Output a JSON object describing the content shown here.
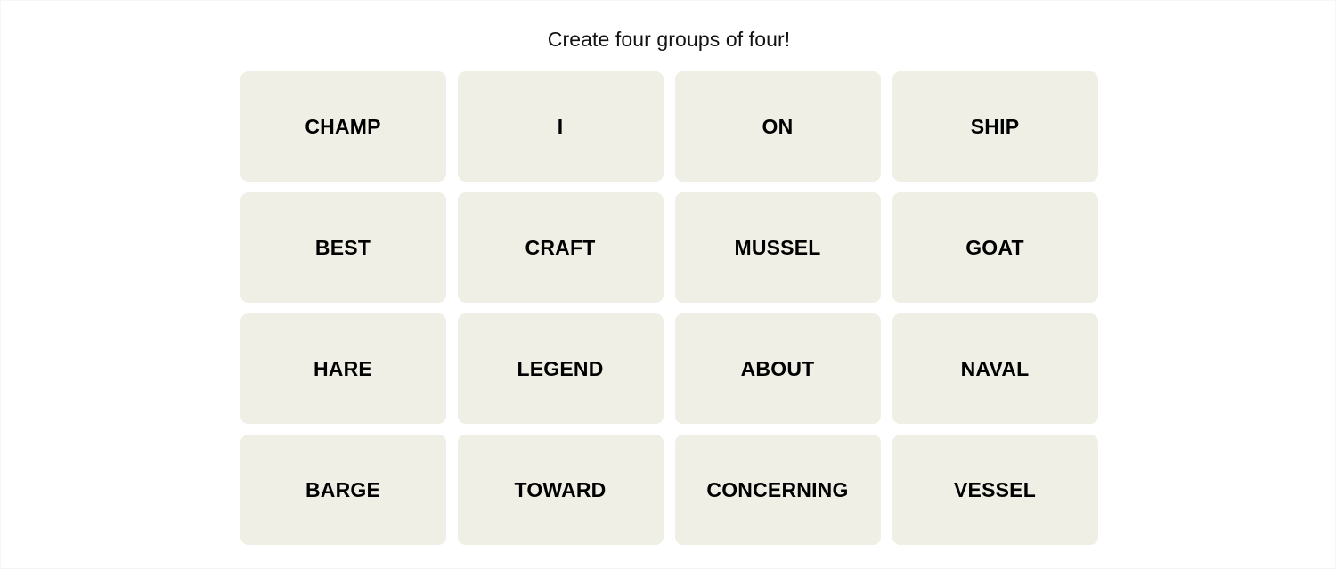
{
  "page": {
    "background_color": "#ffffff",
    "title": "Create four groups of four!"
  },
  "board": {
    "tile_background_color": "#efefe6",
    "tile_text_color": "#000000",
    "rows": 4,
    "columns": 4,
    "tiles": [
      {
        "label": "CHAMP"
      },
      {
        "label": "I"
      },
      {
        "label": "ON"
      },
      {
        "label": "SHIP"
      },
      {
        "label": "BEST"
      },
      {
        "label": "CRAFT"
      },
      {
        "label": "MUSSEL"
      },
      {
        "label": "GOAT"
      },
      {
        "label": "HARE"
      },
      {
        "label": "LEGEND"
      },
      {
        "label": "ABOUT"
      },
      {
        "label": "NAVAL"
      },
      {
        "label": "BARGE"
      },
      {
        "label": "TOWARD"
      },
      {
        "label": "CONCERNING"
      },
      {
        "label": "VESSEL"
      }
    ]
  }
}
